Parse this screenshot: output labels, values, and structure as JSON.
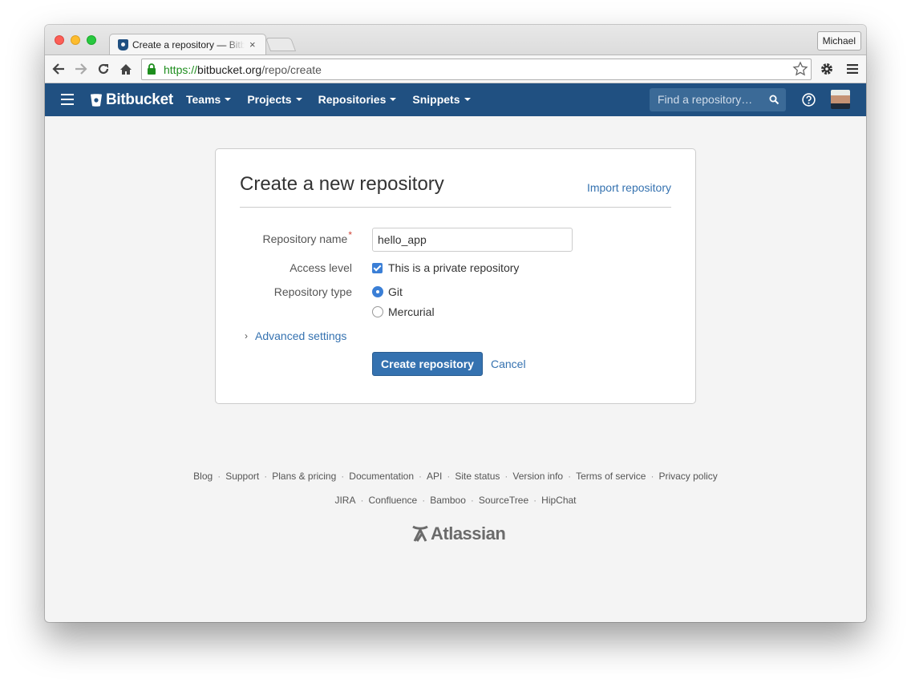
{
  "browser": {
    "tab_title": "Create a repository — Bitbucket",
    "tab_close": "×",
    "profile_name": "Michael",
    "url_scheme": "https://",
    "url_host": "bitbucket.org",
    "url_path": "/repo/create"
  },
  "header": {
    "logo_text": "Bitbucket",
    "nav": [
      "Teams",
      "Projects",
      "Repositories",
      "Snippets"
    ],
    "search_placeholder": "Find a repository…",
    "brand_color": "#205081"
  },
  "form": {
    "title": "Create a new repository",
    "import_link": "Import repository",
    "repo_name_label": "Repository name",
    "required_marker": "*",
    "repo_name_value": "hello_app",
    "access_label": "Access level",
    "private_label": "This is a private repository",
    "private_checked": true,
    "type_label": "Repository type",
    "type_options": [
      "Git",
      "Mercurial"
    ],
    "type_selected": "Git",
    "advanced_chevron": "›",
    "advanced_label": "Advanced settings",
    "create_button": "Create repository",
    "cancel_link": "Cancel"
  },
  "footer": {
    "row1": [
      "Blog",
      "Support",
      "Plans & pricing",
      "Documentation",
      "API",
      "Site status",
      "Version info",
      "Terms of service",
      "Privacy policy"
    ],
    "row2": [
      "JIRA",
      "Confluence",
      "Bamboo",
      "SourceTree",
      "HipChat"
    ],
    "separator": "·",
    "brand": "Atlassian"
  }
}
